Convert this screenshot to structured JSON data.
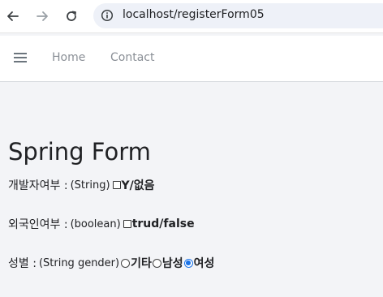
{
  "browser": {
    "url": "localhost/registerForm05",
    "icons": [
      "back-arrow-icon",
      "forward-arrow-icon",
      "reload-icon",
      "info-icon"
    ]
  },
  "navbar": {
    "menu_icon": "hamburger-icon",
    "links": [
      "Home",
      "Contact"
    ]
  },
  "page": {
    "title": "Spring Form"
  },
  "form": {
    "developer": {
      "label": "개발자여부 :",
      "type": "(String)",
      "checkbox_label": "Y/없음",
      "checked": false
    },
    "foreigner": {
      "label": "외국인여부 :",
      "type": "(boolean)",
      "checkbox_label": "trud/false",
      "checked": false
    },
    "gender": {
      "label": "성별 :",
      "type": "(String gender)",
      "options": [
        {
          "label": "기타",
          "checked": false
        },
        {
          "label": "남성",
          "checked": false
        },
        {
          "label": "여성",
          "checked": true
        }
      ]
    }
  },
  "colors": {
    "background": "#f3f4f7",
    "accent": "#1a73e8",
    "nav_link": "#8a8f96"
  }
}
